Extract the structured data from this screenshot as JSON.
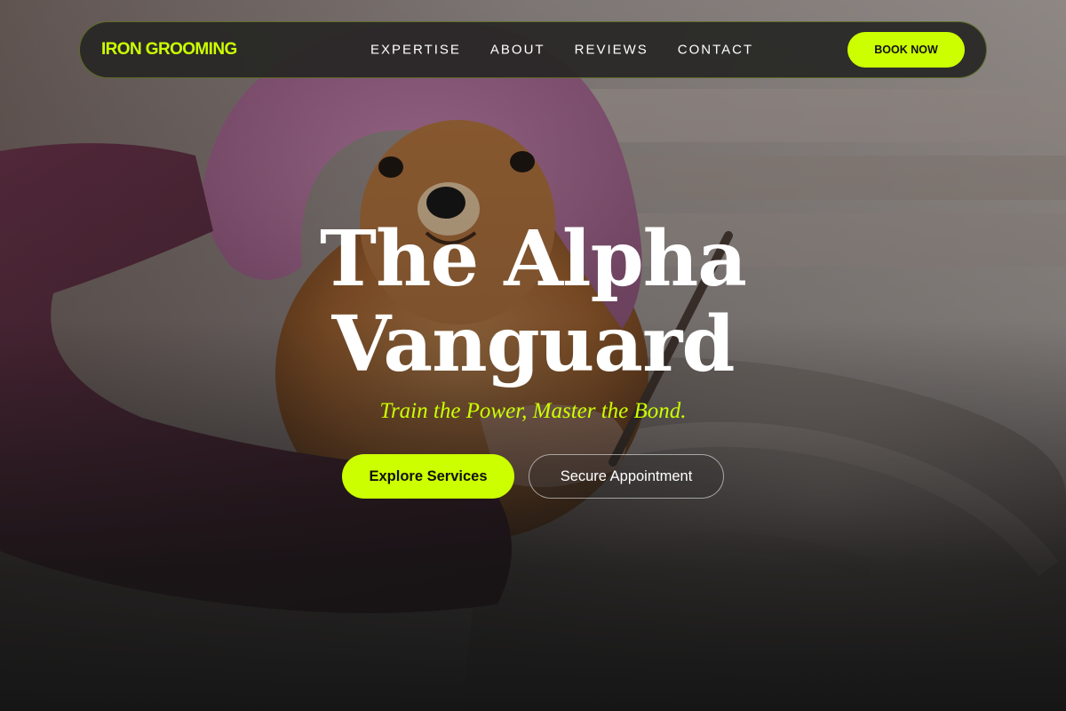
{
  "brand": {
    "name": "IRON GROOMING",
    "accent_color": "#ccff00"
  },
  "nav": {
    "links": [
      "EXPERTISE",
      "ABOUT",
      "REVIEWS",
      "CONTACT"
    ],
    "cta_label": "BOOK NOW"
  },
  "hero": {
    "background": "photo-of-pomeranian-wrapped-in-pink-towel-being-groomed",
    "headline_line1": "The Alpha",
    "headline_line2": "Vanguard",
    "tagline": "Train the Power, Master the Bond.",
    "primary_button": "Explore Services",
    "secondary_button": "Secure Appointment"
  }
}
